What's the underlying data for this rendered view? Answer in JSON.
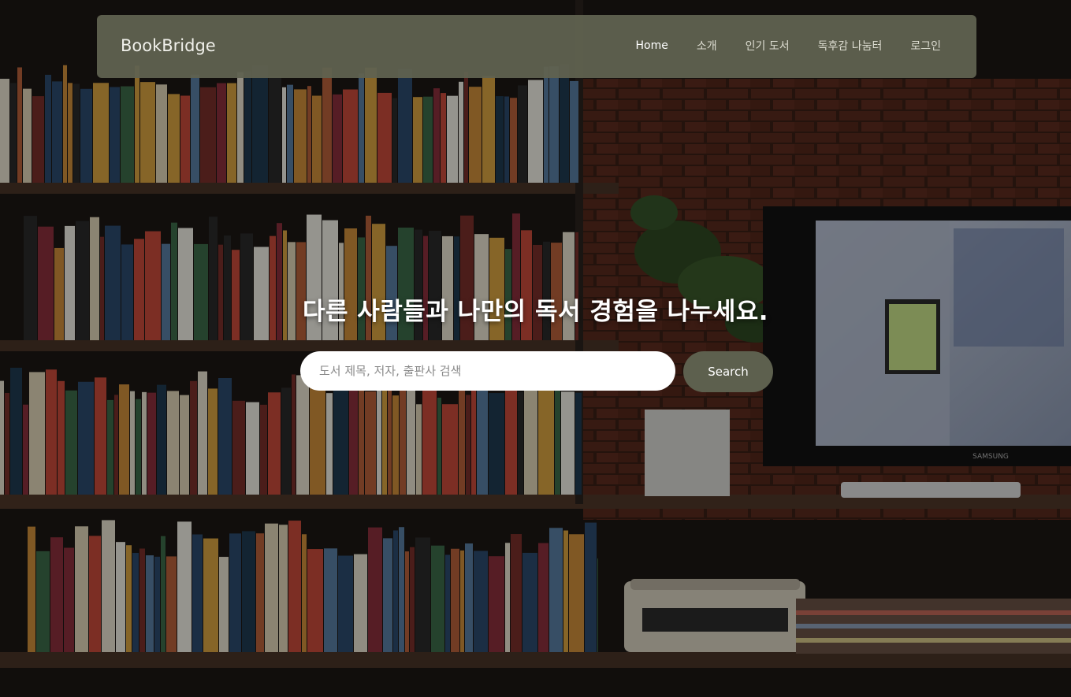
{
  "navbar": {
    "brand": "BookBridge",
    "links": [
      "Home",
      "소개",
      "인기 도서",
      "독후감 나눔터",
      "로그인"
    ],
    "active": "Home"
  },
  "hero": {
    "title": "다른 사람들과 나만의 독서 경험을 나누세요.",
    "search_placeholder": "도서 제목, 저자, 출판사 검색",
    "search_value": "",
    "search_button": "Search"
  },
  "background": {
    "image": "bookshelf-photo",
    "monitor_brand": "SAMSUNG",
    "accent_color": "#5d604e",
    "navbar_color": "#606250"
  }
}
